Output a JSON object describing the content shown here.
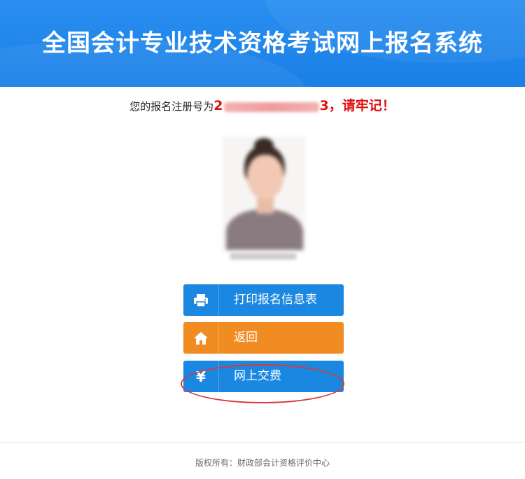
{
  "header": {
    "title": "全国会计专业技术资格考试网上报名系统"
  },
  "registration": {
    "prefix": "您的报名注册号为",
    "number_first": "2",
    "number_last": "3",
    "suffix": "，请牢记！"
  },
  "buttons": {
    "print": {
      "label": "打印报名信息表",
      "icon": "printer-icon"
    },
    "back": {
      "label": "返回",
      "icon": "home-icon"
    },
    "pay": {
      "label": "网上交费",
      "icon": "yen-icon",
      "icon_glyph": "¥"
    }
  },
  "footer": {
    "text": "版权所有：财政部会计资格评价中心"
  },
  "colors": {
    "header": "#1a7fe6",
    "blue_button": "#1a87e0",
    "orange_button": "#f08c22",
    "warning_red": "#e01010"
  }
}
